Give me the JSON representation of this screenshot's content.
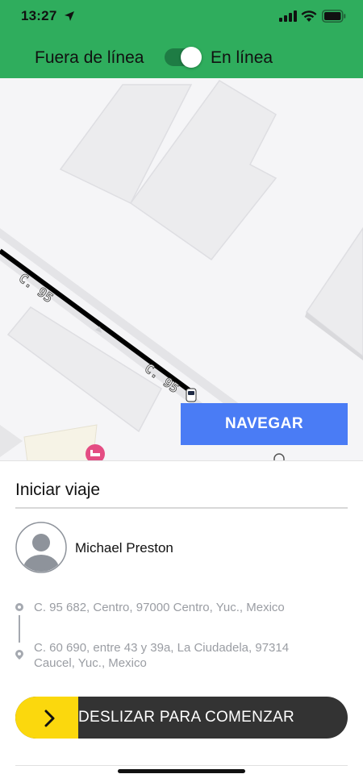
{
  "status_bar": {
    "time": "13:27"
  },
  "header": {
    "offline_label": "Fuera de línea",
    "online_label": "En línea",
    "online": true
  },
  "map": {
    "street_labels": [
      "C. 95",
      "C. 95"
    ],
    "navigate_label": "NAVEGAR"
  },
  "trip": {
    "title": "Iniciar viaje",
    "passenger_name": "Michael Preston",
    "pickup_address": "C. 95 682, Centro, 97000 Centro, Yuc., Mexico",
    "dropoff_address_line1": "C. 60 690, entre 43 y 39a, La Ciudadela, 97314",
    "dropoff_address_line2": "Caucel, Yuc., Mexico",
    "slide_label": "DESLIZAR PARA COMENZAR"
  },
  "colors": {
    "header_green": "#2fad5d",
    "navigate_blue": "#4a7cf5",
    "slider_yellow": "#fbd80d",
    "slider_dark": "#333333"
  },
  "icons": [
    "location-arrow-icon",
    "signal-icon",
    "wifi-icon",
    "battery-icon",
    "car-icon",
    "hotel-icon",
    "pin-icon",
    "avatar-icon",
    "chevron-right-icon"
  ]
}
